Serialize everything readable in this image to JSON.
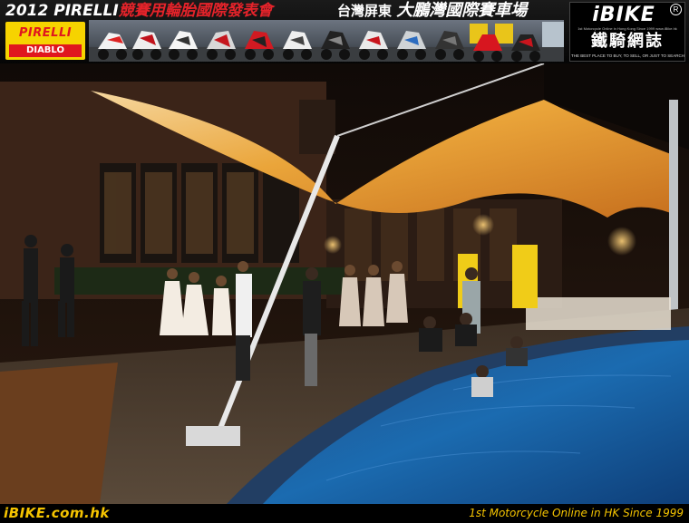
{
  "banner": {
    "title_year": "2012 PIRELLI",
    "title_event": "競賽用輪胎國際發表會",
    "venue_region": "台灣屏東",
    "venue_name": "大鵬灣國際賽車場",
    "pirelli_logo": {
      "name": "PIRELLI",
      "sub": "DIABLO"
    },
    "ibike_logo": {
      "name": "iBIKE",
      "reg": "R",
      "small_line": "1st Motorcycle Online in Hong Kong Since 1999 www.iBike.hk",
      "cn": "鐵騎網誌",
      "slogan": "THE BEST PLACE TO BUY, TO SELL, OR JUST TO SEARCH"
    }
  },
  "footer": {
    "logo_text": "iBIKE.com.hk",
    "tagline": "1st  Motorcycle Online in HK Since 1999"
  },
  "colors": {
    "brand_yellow": "#f5c400",
    "pirelli_red": "#e0161e",
    "canopy": "#e39a2a",
    "pool": "#1b5fa8"
  }
}
